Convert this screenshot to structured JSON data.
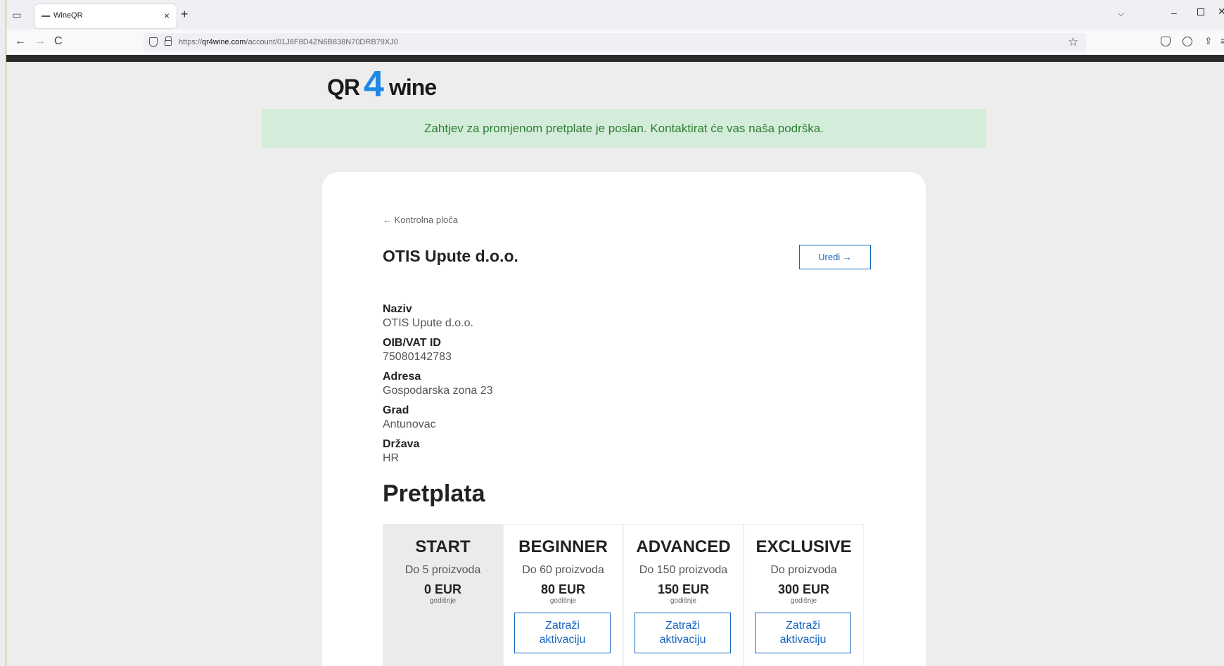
{
  "browser": {
    "tab_title": "WineQR",
    "tab_close": "×",
    "new_tab": "+",
    "url_domain": "qr4wine.com",
    "url_prefix": "https://",
    "url_path": "/account/01J8F8D4ZN6B838N70DRB79XJ0",
    "back": "←",
    "forward": "→",
    "reload": "C",
    "bookmark_star": "☆",
    "tabs_menu": "⌵",
    "minimize": "–",
    "close": "✕",
    "extensions": "⇪",
    "menu": "≡"
  },
  "logo": {
    "part1": "QR",
    "part2": "4",
    "part3": "wine"
  },
  "alert": {
    "message": "Zahtjev za promjenom pretplate je poslan. Kontaktirat će vas naša podrška."
  },
  "account": {
    "back_link": "← Kontrolna ploča",
    "title": "OTIS Upute d.o.o.",
    "edit_label": "Uredi →",
    "fields": [
      {
        "label": "Naziv",
        "value": "OTIS Upute d.o.o."
      },
      {
        "label": "OIB/VAT ID",
        "value": "75080142783"
      },
      {
        "label": "Adresa",
        "value": "Gospodarska zona 23"
      },
      {
        "label": "Grad",
        "value": "Antunovac"
      },
      {
        "label": "Država",
        "value": "HR"
      }
    ]
  },
  "subscription": {
    "title": "Pretplata",
    "plans": [
      {
        "name": "START",
        "desc": "Do 5 proizvoda",
        "price": "0 EUR",
        "period": "godišnje",
        "action": ""
      },
      {
        "name": "BEGINNER",
        "desc": "Do 60 proizvoda",
        "price": "80 EUR",
        "period": "godišnje",
        "action": "Zatraži aktivaciju"
      },
      {
        "name": "ADVANCED",
        "desc": "Do 150 proizvoda",
        "price": "150 EUR",
        "period": "godišnje",
        "action": "Zatraži aktivaciju"
      },
      {
        "name": "EXCLUSIVE",
        "desc": "Do proizvoda",
        "price": "300 EUR",
        "period": "godišnje",
        "action": "Zatraži aktivaciju"
      }
    ]
  },
  "colors": {
    "accent": "#1565c0",
    "alert_bg": "#d4edda",
    "alert_text": "#2e7d32",
    "logo_blue": "#1e88e5"
  }
}
